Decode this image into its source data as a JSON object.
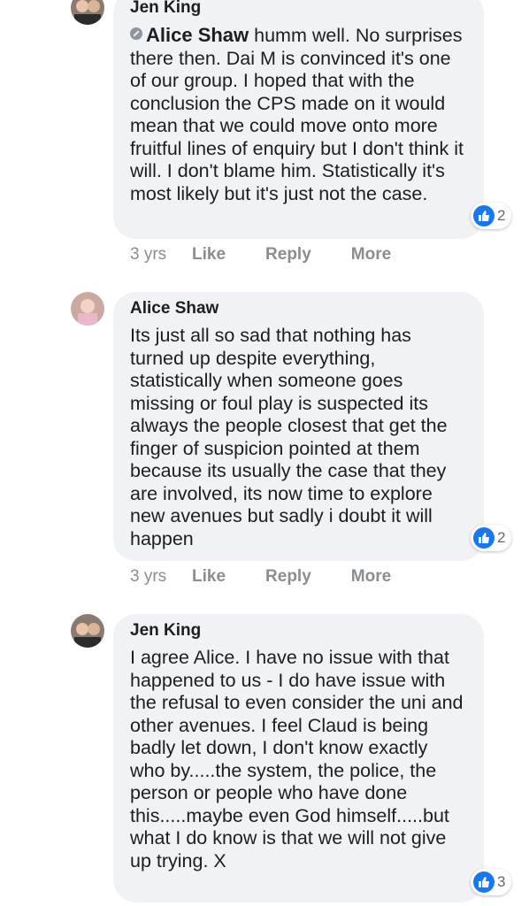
{
  "comments": [
    {
      "author": "Jen King",
      "mention": "Alice Shaw",
      "text": " humm well. No surprises there then. Dai M is convinced it's one of our group. I hoped that with the conclusion the CPS made on it would mean that we could move onto more fruitful lines of enquiry but I don't think it will. I don't blame him. Statistically it's most likely but it's just not the case.",
      "reactions": "2",
      "time": "3 yrs",
      "like_label": "Like",
      "reply_label": "Reply",
      "more_label": "More"
    },
    {
      "author": "Alice Shaw",
      "text": "Its just all so sad that nothing has turned up despite everything, statistically when someone goes missing or foul play is suspected its always the people closest that get the finger of suspicion pointed at them because its usually the case that they are involved, its now time to explore new avenues but sadly i doubt it will happen",
      "reactions": "2",
      "time": "3 yrs",
      "like_label": "Like",
      "reply_label": "Reply",
      "more_label": "More"
    },
    {
      "author": "Jen King",
      "text": "I agree Alice. I have no issue with that happened to us - I do have issue with the refusal to even consider the uni and other avenues. I feel Claud is being badly let down, I don't know exactly who by.....the system, the police, the person or people who have done this.....maybe even God himself.....but what I do know is that we will not give up trying. X",
      "reactions": "3"
    }
  ],
  "colors": {
    "bubble": "#f0f2f5",
    "like_blue": "#1877f2",
    "muted_text": "#8a8d91"
  },
  "icons": [
    "avatar",
    "mention-icon",
    "like-icon"
  ]
}
